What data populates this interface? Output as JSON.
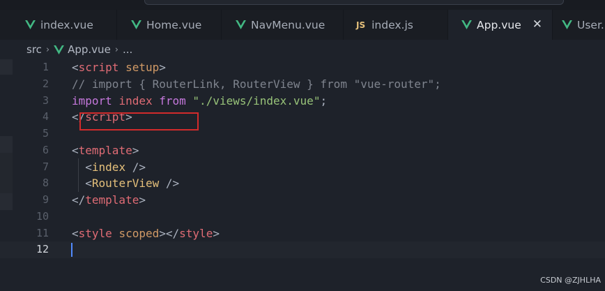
{
  "tabs": [
    {
      "label": "index.vue",
      "icon": "vue-icon"
    },
    {
      "label": "Home.vue",
      "icon": "vue-icon"
    },
    {
      "label": "NavMenu.vue",
      "icon": "vue-icon"
    },
    {
      "label": "index.js",
      "icon": "js-icon",
      "badge": "JS"
    },
    {
      "label": "App.vue",
      "icon": "vue-icon",
      "active": true,
      "close": "✕"
    },
    {
      "label": "User.",
      "icon": "vue-icon"
    }
  ],
  "breadcrumb": {
    "root": "src",
    "file": "App.vue",
    "tail": "...",
    "sep": "›"
  },
  "editor": {
    "line_numbers": [
      "1",
      "2",
      "3",
      "4",
      "5",
      "6",
      "7",
      "8",
      "9",
      "10",
      "11",
      "12"
    ],
    "active_line": "12",
    "lines": [
      [
        [
          "punct",
          "<"
        ],
        [
          "tag",
          "script"
        ],
        [
          "punct",
          " "
        ],
        [
          "attr",
          "setup"
        ],
        [
          "punct",
          ">"
        ]
      ],
      [
        [
          "comment",
          "// import { RouterLink, RouterView } from \"vue-router\";"
        ]
      ],
      [
        [
          "kw",
          "import"
        ],
        [
          "punct",
          " "
        ],
        [
          "tag",
          "index"
        ],
        [
          "punct",
          " "
        ],
        [
          "kw",
          "from"
        ],
        [
          "punct",
          " "
        ],
        [
          "str",
          "\"./views/index.vue\""
        ],
        [
          "punct",
          ";"
        ]
      ],
      [
        [
          "punct",
          "</"
        ],
        [
          "tag",
          "script"
        ],
        [
          "punct",
          ">"
        ]
      ],
      [],
      [
        [
          "punct",
          "<"
        ],
        [
          "tag",
          "template"
        ],
        [
          "punct",
          ">"
        ]
      ],
      [
        [
          "punct",
          "  <"
        ],
        [
          "ident",
          "index"
        ],
        [
          "punct",
          " />"
        ]
      ],
      [
        [
          "punct",
          "  <"
        ],
        [
          "ident",
          "RouterView"
        ],
        [
          "punct",
          " />"
        ]
      ],
      [
        [
          "punct",
          "</"
        ],
        [
          "tag",
          "template"
        ],
        [
          "punct",
          ">"
        ]
      ],
      [],
      [
        [
          "punct",
          "<"
        ],
        [
          "tag",
          "style"
        ],
        [
          "punct",
          " "
        ],
        [
          "attr",
          "scoped"
        ],
        [
          "punct",
          "></"
        ],
        [
          "tag",
          "style"
        ],
        [
          "punct",
          ">"
        ]
      ],
      []
    ]
  },
  "watermark": "CSDN @ZJHLHA",
  "colors": {
    "background": "#1e222a",
    "tag": "#e06c75",
    "attribute": "#d19a66",
    "keyword": "#c678dd",
    "string": "#98c379",
    "comment": "#7f848e",
    "component": "#e5c07b",
    "vue_icon": "#42b883",
    "annotation_box": "#d22b2b"
  }
}
